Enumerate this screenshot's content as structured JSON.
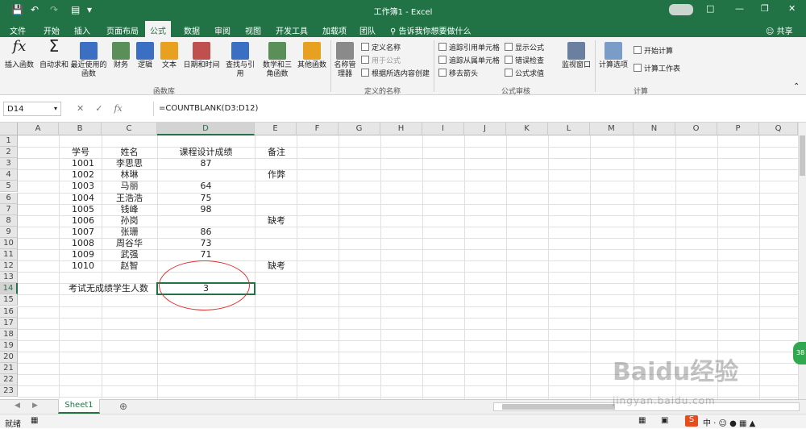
{
  "app": {
    "title": "工作簿1 - Excel",
    "share": "共享",
    "tell_me": "告诉我你想要做什么"
  },
  "colors": {
    "brand": "#217346",
    "annotation": "#e03030"
  },
  "tabs": [
    "文件",
    "开始",
    "插入",
    "页面布局",
    "公式",
    "数据",
    "审阅",
    "视图",
    "开发工具",
    "加载项",
    "团队"
  ],
  "active_tab": "公式",
  "ribbon": {
    "groups": [
      {
        "name": "函数库",
        "buttons": [
          "插入函数",
          "自动求和",
          "最近使用的函数",
          "财务",
          "逻辑",
          "文本",
          "日期和时间",
          "查找与引用",
          "数学和三角函数",
          "其他函数"
        ]
      },
      {
        "name": "定义的名称",
        "buttons": [
          "名称管理器",
          "定义名称",
          "用于公式",
          "根据所选内容创建"
        ]
      },
      {
        "name": "公式审核",
        "buttons": [
          "追踪引用单元格",
          "追踪从属单元格",
          "移去箭头",
          "显示公式",
          "错误检查",
          "公式求值",
          "监视窗口"
        ]
      },
      {
        "name": "计算",
        "buttons": [
          "计算选项",
          "开始计算",
          "计算工作表"
        ]
      }
    ]
  },
  "formula_bar": {
    "name_box": "D14",
    "formula": "=COUNTBLANK(D3:D12)"
  },
  "columns": [
    "A",
    "B",
    "C",
    "D",
    "E",
    "F",
    "G",
    "H",
    "I",
    "J",
    "K",
    "L",
    "M",
    "N",
    "O",
    "P",
    "Q"
  ],
  "rows": [
    "1",
    "2",
    "3",
    "4",
    "5",
    "6",
    "7",
    "8",
    "9",
    "10",
    "11",
    "12",
    "13",
    "14",
    "15",
    "16",
    "17",
    "18",
    "19",
    "20",
    "21",
    "22",
    "23"
  ],
  "headers": {
    "id": "学号",
    "name": "姓名",
    "score": "课程设计成绩",
    "note": "备注"
  },
  "students": [
    {
      "id": "1001",
      "name": "李思思",
      "score": "87",
      "note": ""
    },
    {
      "id": "1002",
      "name": "林琳",
      "score": "",
      "note": "作弊"
    },
    {
      "id": "1003",
      "name": "马丽",
      "score": "64",
      "note": ""
    },
    {
      "id": "1004",
      "name": "王浩浩",
      "score": "75",
      "note": ""
    },
    {
      "id": "1005",
      "name": "钱峰",
      "score": "98",
      "note": ""
    },
    {
      "id": "1006",
      "name": "孙岗",
      "score": "",
      "note": "缺考"
    },
    {
      "id": "1007",
      "name": "张珊",
      "score": "86",
      "note": ""
    },
    {
      "id": "1008",
      "name": "周谷华",
      "score": "73",
      "note": ""
    },
    {
      "id": "1009",
      "name": "武强",
      "score": "71",
      "note": ""
    },
    {
      "id": "1010",
      "name": "赵智",
      "score": "",
      "note": "缺考"
    }
  ],
  "summary": {
    "label": "考试无成绩学生人数",
    "value": "3"
  },
  "sheet": {
    "name": "Sheet1"
  },
  "status": {
    "mode": "就绪"
  },
  "watermark": {
    "text": "Baidu经验",
    "url": "jingyan.baidu.com"
  },
  "badge": "38"
}
